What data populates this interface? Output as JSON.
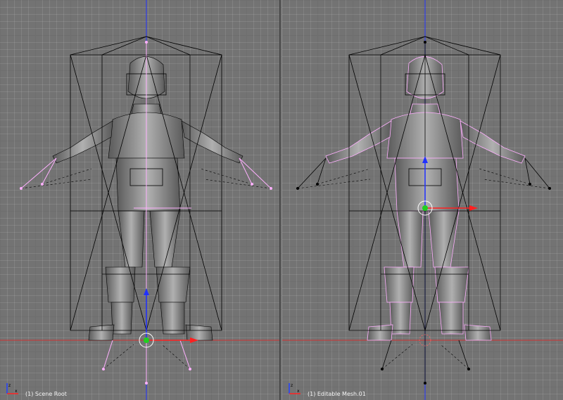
{
  "viewports": [
    {
      "id": "left",
      "status": "(1) Scene Root"
    },
    {
      "id": "right",
      "status": "(1) Editable Mesh.01"
    }
  ],
  "colors": {
    "grid_bg": "#737373",
    "wire": "#000000",
    "selected_wire": "#ffb0ff",
    "axis_x": "#ff2020",
    "axis_y": "#20d020",
    "axis_z": "#2040ff",
    "mesh_body": "#8a8a8a"
  },
  "icons": {
    "axis_gizmo": "xyz-axis-icon"
  }
}
